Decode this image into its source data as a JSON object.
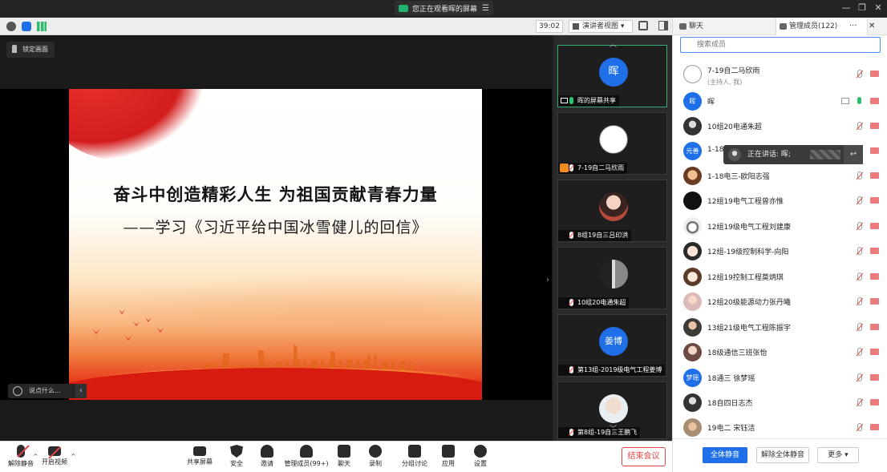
{
  "banner": {
    "share_status": "您正在观看晖的屏幕"
  },
  "window": {
    "minimize": "—",
    "restore": "❐",
    "close": "✕"
  },
  "toolbar": {
    "timer": "39:02",
    "view_mode": "演讲者视图 ▾"
  },
  "share": {
    "lock_label": "锁定画面",
    "slide_title": "奋斗中创造精彩人生 为祖国贡献青春力量",
    "slide_subtitle": "——学习《习近平给中国冰雪健儿的回信》",
    "chat_placeholder": "说点什么...",
    "collapse": "‹",
    "panel_toggle": "›"
  },
  "video_strip": {
    "up": "︿",
    "down": "﹀",
    "tiles": [
      {
        "name": "晖的屏幕共享",
        "avatar_text": "晖"
      },
      {
        "name": "7-19自二马欣雨",
        "avatar_text": ""
      },
      {
        "name": "8组19自三吕印洪",
        "avatar_text": ""
      },
      {
        "name": "10组20电通朱超",
        "avatar_text": ""
      },
      {
        "name": "第13组-2019级电气工程姜博",
        "avatar_text": "姜博"
      },
      {
        "name": "第8组-19自三王鹏飞",
        "avatar_text": ""
      }
    ]
  },
  "panel": {
    "tab_chat": "聊天",
    "tab_members": "管理成员(122)",
    "tab_more": "···",
    "tab_close": "✕",
    "search_placeholder": "搜索成员",
    "mute_all": "全体静音",
    "unmute_all": "解除全体静音",
    "more": "更多 ▾"
  },
  "members": [
    {
      "name": "7-19自二马欣雨",
      "sub": "(主持人, 我)",
      "avatar_text": ""
    },
    {
      "name": "晖",
      "sub": "",
      "avatar_text": "晖"
    },
    {
      "name": "10组20电通朱超",
      "sub": "",
      "avatar_text": ""
    },
    {
      "name": "1-18",
      "sub": "",
      "avatar_text": "元善"
    },
    {
      "name": "1-18电三-欧阳志强",
      "sub": "",
      "avatar_text": ""
    },
    {
      "name": "12组19电气工程曾亦惟",
      "sub": "",
      "avatar_text": ""
    },
    {
      "name": "12组19级电气工程刘建康",
      "sub": "",
      "avatar_text": ""
    },
    {
      "name": "12组-19级控制科学-向阳",
      "sub": "",
      "avatar_text": ""
    },
    {
      "name": "12组19控制工程莫炳琪",
      "sub": "",
      "avatar_text": ""
    },
    {
      "name": "12组20级能源动力张丹曦",
      "sub": "",
      "avatar_text": ""
    },
    {
      "name": "13组21级电气工程陈振宇",
      "sub": "",
      "avatar_text": ""
    },
    {
      "name": "18级通信三班张怡",
      "sub": "",
      "avatar_text": ""
    },
    {
      "name": "18通三 徐梦瑶",
      "sub": "",
      "avatar_text": "梦瑶"
    },
    {
      "name": "18自四日志杰",
      "sub": "",
      "avatar_text": ""
    },
    {
      "name": "19电二 宋钰洁",
      "sub": "",
      "avatar_text": ""
    }
  ],
  "speaking": {
    "label": "正在讲话: 晖;",
    "reply": "↩"
  },
  "controls": {
    "unmute": "解除静音",
    "start_video": "开启视频",
    "share_screen": "共享屏幕",
    "security": "安全",
    "invite": "邀请",
    "manage_members": "管理成员(99+)",
    "chat": "聊天",
    "record": "录制",
    "breakout": "分组讨论",
    "apps": "应用",
    "settings": "设置",
    "end_meeting": "结束会议",
    "caret": "^"
  },
  "colors": {
    "accent": "#1e6fe8",
    "danger": "#e04545",
    "active_tile": "#2fae6f"
  }
}
